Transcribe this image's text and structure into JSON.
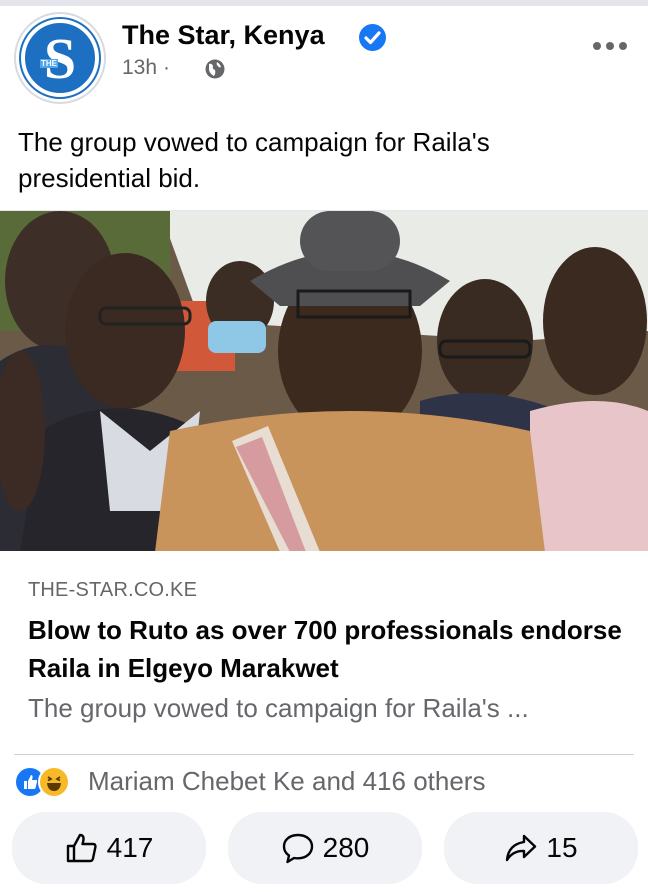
{
  "post": {
    "page_name": "The Star, Kenya",
    "avatar_letter": "S",
    "avatar_small_text": "THE",
    "time": "13h",
    "dot": "·",
    "caption": "The group vowed to campaign for Raila's presidential bid."
  },
  "link": {
    "domain": "THE-STAR.CO.KE",
    "headline": "Blow to Ruto as over 700 professionals endorse Raila in Elgeyo Marakwet",
    "description": "The group vowed to campaign for Raila's ..."
  },
  "reactions": {
    "summary": "Mariam Chebet Ke and 416 others",
    "icons": [
      "like-icon",
      "haha-icon"
    ]
  },
  "actions": {
    "like_count": "417",
    "comment_count": "280",
    "share_count": "15"
  },
  "colors": {
    "facebook_blue": "#1877f2",
    "brand_blue": "#1d6fc2",
    "muted_text": "#65676b",
    "button_bg": "#f0f2f5"
  }
}
